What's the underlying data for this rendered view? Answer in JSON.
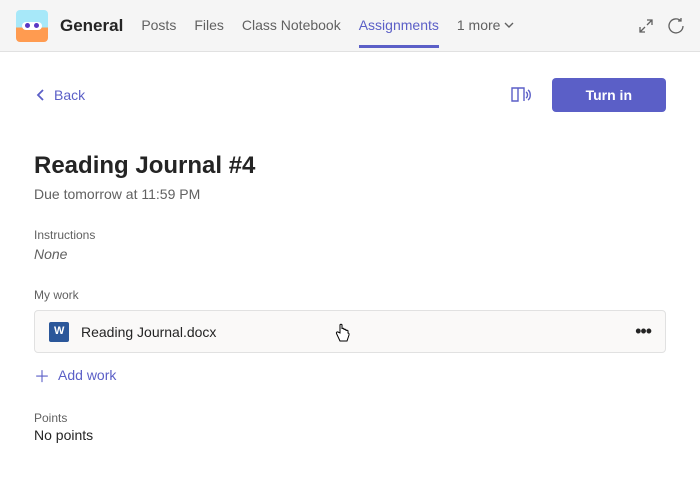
{
  "topbar": {
    "channel": "General",
    "tabs": [
      "Posts",
      "Files",
      "Class Notebook",
      "Assignments"
    ],
    "activeTab": 3,
    "moreLabel": "1 more"
  },
  "back": {
    "label": "Back"
  },
  "turnin": {
    "label": "Turn in"
  },
  "assignment": {
    "title": "Reading Journal #4",
    "due": "Due tomorrow at 11:59 PM"
  },
  "instructions": {
    "label": "Instructions",
    "value": "None"
  },
  "mywork": {
    "label": "My work",
    "file": "Reading Journal.docx",
    "addLabel": "Add work"
  },
  "points": {
    "label": "Points",
    "value": "No points"
  }
}
